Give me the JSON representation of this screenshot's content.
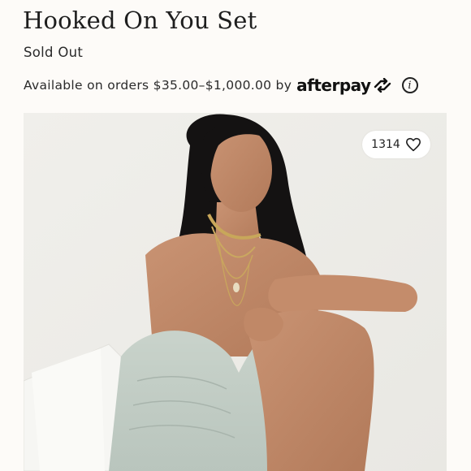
{
  "product": {
    "title": "Hooked On You Set",
    "status": "Sold Out",
    "afterpay_text": "Available on orders $35.00–$1,000.00 by",
    "afterpay_brand": "afterpay",
    "info_icon": "info-icon"
  },
  "image": {
    "like_count": "1314",
    "like_icon": "heart-icon"
  }
}
